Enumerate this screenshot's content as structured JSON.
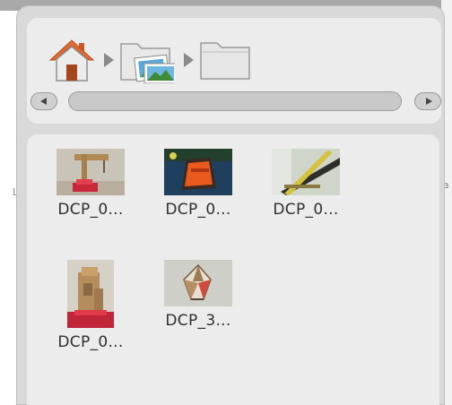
{
  "breadcrumb": {
    "items": [
      {
        "name": "home",
        "icon": "home-icon"
      },
      {
        "name": "pictures",
        "icon": "pictures-folder-icon"
      },
      {
        "name": "folder",
        "icon": "folder-icon"
      }
    ]
  },
  "scrollbar": {
    "left_icon": "arrow-left-icon",
    "right_icon": "arrow-right-icon"
  },
  "files": [
    {
      "label": "DCP_0...",
      "thumb": "photo-wooden-crane"
    },
    {
      "label": "DCP_0...",
      "thumb": "photo-orange-box-on-blue"
    },
    {
      "label": "DCP_0...",
      "thumb": "photo-yellow-stick"
    },
    {
      "label": "DCP_0...",
      "thumb": "photo-wooden-structure"
    },
    {
      "label": "DCP_3...",
      "thumb": "photo-geometric-sculpture"
    }
  ],
  "colors": {
    "panel_bg": "#d9d9d9",
    "area_bg": "#ececec",
    "home_roof": "#e26a2c",
    "folder_fill": "#e6e6e6"
  }
}
